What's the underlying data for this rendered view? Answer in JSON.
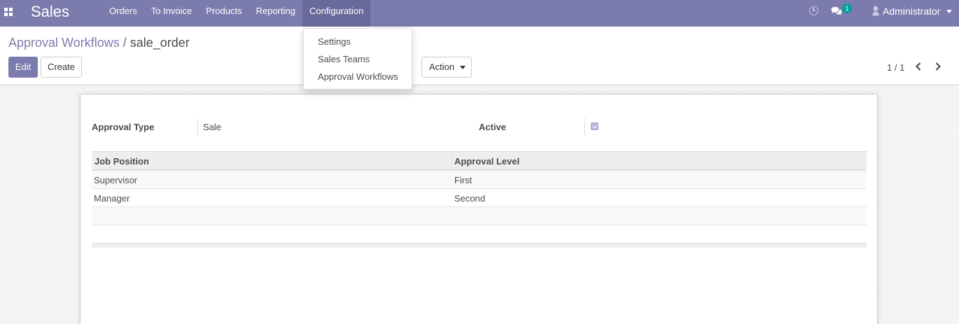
{
  "navbar": {
    "app_name": "Sales",
    "menu": [
      {
        "label": "Orders"
      },
      {
        "label": "To Invoice"
      },
      {
        "label": "Products"
      },
      {
        "label": "Reporting"
      },
      {
        "label": "Configuration"
      }
    ],
    "chat_badge": "1",
    "user_name": "Administrator"
  },
  "dropdown": {
    "items": [
      {
        "label": "Settings"
      },
      {
        "label": "Sales Teams"
      },
      {
        "label": "Approval Workflows"
      }
    ]
  },
  "breadcrumb": {
    "parent": "Approval Workflows",
    "separator": "/",
    "current": "sale_order"
  },
  "buttons": {
    "edit": "Edit",
    "create": "Create",
    "action": "Action"
  },
  "pager": {
    "value": "1 / 1"
  },
  "form": {
    "approval_type_label": "Approval Type",
    "approval_type_value": "Sale",
    "active_label": "Active",
    "active_checked": true
  },
  "table": {
    "headers": [
      "Job Position",
      "Approval Level"
    ],
    "rows": [
      {
        "job_position": "Supervisor",
        "approval_level": "First"
      },
      {
        "job_position": "Manager",
        "approval_level": "Second"
      }
    ]
  },
  "colors": {
    "brand": "#7c7bad",
    "badge": "#00a09d"
  }
}
